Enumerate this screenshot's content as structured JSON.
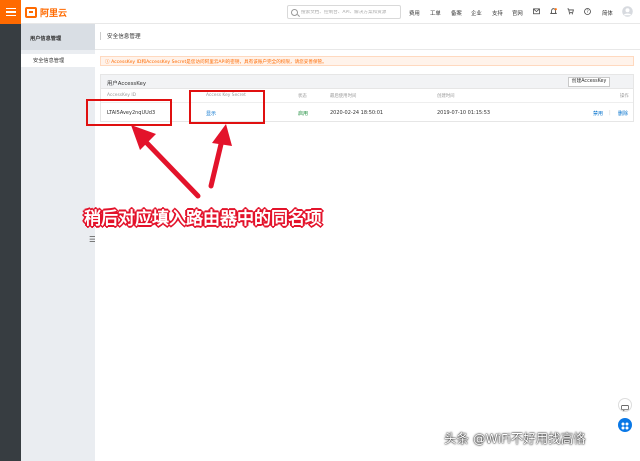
{
  "topbar": {
    "logo_text": "阿里云",
    "search_placeholder": "搜索文档、控制台、API、解决方案和资源",
    "nav": [
      "费用",
      "工单",
      "备案",
      "企业",
      "支持",
      "官网"
    ],
    "lang": "简体"
  },
  "sidebar": {
    "title": "用户信息管理",
    "items": [
      {
        "label": "安全信息管理"
      }
    ]
  },
  "main": {
    "title": "安全信息管理",
    "alert": "AccessKey ID和AccessKey Secret是您访问阿里云API的密钥，具有该账户完全的权限，请您妥善保管。",
    "panel_title": "用户AccessKey",
    "create_button": "创建AccessKey",
    "columns": [
      "AccessKey ID",
      "Access Key Secret",
      "状态",
      "最后使用时间",
      "创建时间",
      "操作"
    ],
    "rows": [
      {
        "access_key_id": "LTAI5Avey2nqUUd3",
        "secret_action": "显示",
        "status": "启用",
        "last_used": "2020-02-24 18:50:01",
        "created": "2019-07-10 01:15:53",
        "actions": [
          "禁用",
          "删除"
        ]
      }
    ]
  },
  "annotation": {
    "text": "稍后对应填入路由器中的同名项",
    "color": "#e3132b"
  },
  "watermark": "头条 @WiFi不好用找高恪",
  "colors": {
    "brand": "#ff6a00",
    "link": "#0070cc",
    "status_enabled": "#1e8e3e",
    "dark_sidebar": "#373d41"
  }
}
